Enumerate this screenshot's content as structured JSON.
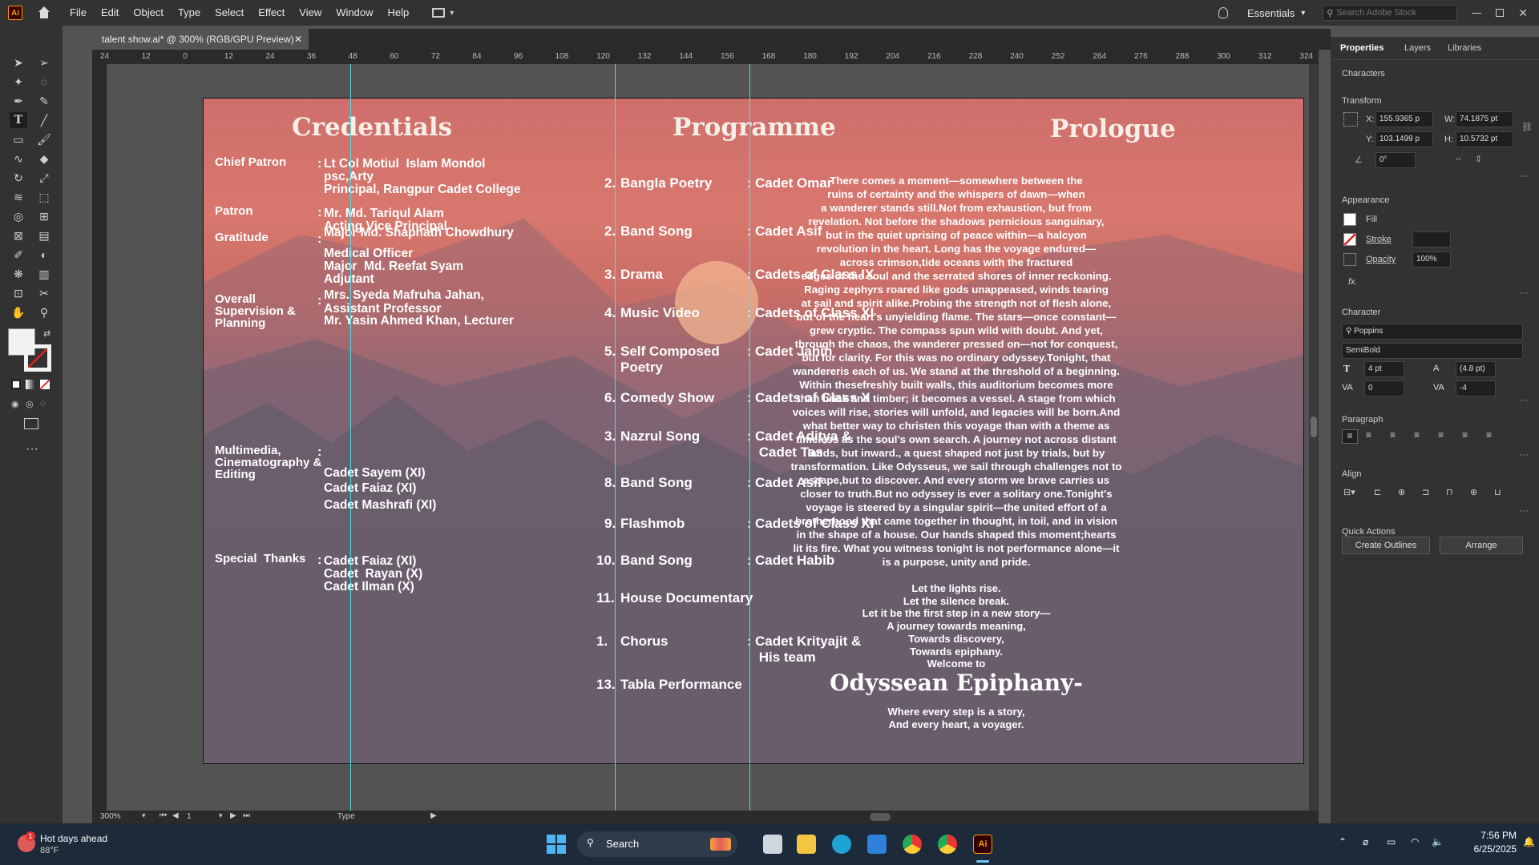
{
  "app": {
    "logo": "Ai",
    "menus": [
      "File",
      "Edit",
      "Object",
      "Type",
      "Select",
      "Effect",
      "View",
      "Window",
      "Help"
    ],
    "workspace": "Essentials",
    "search_placeholder": "Search Adobe Stock"
  },
  "document": {
    "tab_title": "talent show.ai* @ 300% (RGB/GPU Preview)"
  },
  "ruler_ticks": [
    "24",
    "12",
    "0",
    "12",
    "24",
    "36",
    "48",
    "60",
    "72",
    "84",
    "96",
    "108",
    "120",
    "132",
    "144",
    "156",
    "168",
    "180",
    "192",
    "204",
    "216",
    "228",
    "240",
    "252",
    "264",
    "276",
    "288",
    "300",
    "312",
    "324"
  ],
  "artboard": {
    "credentials": {
      "heading": "Credentials",
      "rows": [
        {
          "label": "Chief Patron",
          "sep": ":",
          "lines": [
            "Lt Col Motiul  Islam Mondol",
            "psc,Arty",
            "Principal, Rangpur Cadet College"
          ]
        },
        {
          "label": "Patron",
          "sep": ":",
          "lines": [
            "Mr. Md. Tariqul Alam",
            "Acting Vice Principal"
          ]
        },
        {
          "label": "Gratitude",
          "sep": ":",
          "lines": [
            "Major Md. Shaphath Chowdhury",
            "Medical Officer",
            "Major  Md. Reefat Syam",
            "Adjutant"
          ]
        },
        {
          "label": "Overall\nSupervision &\nPlanning",
          "sep": ":",
          "lines": [
            "Mrs. Syeda Mafruha Jahan,",
            "Assistant Professor",
            "Mr. Yasin Ahmed Khan, Lecturer"
          ]
        },
        {
          "label": "Multimedia,\nCinematography &\nEditing",
          "sep": ":",
          "lines": [
            "Cadet Sayem (XI)",
            "Cadet Faiaz (XI)",
            "Cadet Mashrafi (XI)"
          ]
        },
        {
          "label": "Special  Thanks",
          "sep": ":",
          "lines": [
            "Cadet Faiaz (XI)",
            "Cadet  Rayan (X)",
            "Cadet Ilman (X)"
          ]
        }
      ]
    },
    "programme": {
      "heading": "Programme",
      "items": [
        {
          "num": "2.",
          "name": "Bangla Poetry",
          "sep": ":",
          "by": "Cadet Omar"
        },
        {
          "num": "2.",
          "name": "Band Song",
          "sep": ":",
          "by": "Cadet Asif"
        },
        {
          "num": "3.",
          "name": "Drama",
          "sep": ":",
          "by": "Cadets of Class IX"
        },
        {
          "num": "4.",
          "name": "Music Video",
          "sep": ":",
          "by": "Cadets of Class XI"
        },
        {
          "num": "5.",
          "name": "Self Composed\nPoetry",
          "sep": ":",
          "by": "Cadet Jahin"
        },
        {
          "num": "6.",
          "name": "Comedy Show",
          "sep": ":",
          "by": "Cadets of Class X"
        },
        {
          "num": "3.",
          "name": "Nazrul Song",
          "sep": ":",
          "by": "Cadet Aditya &\n Cadet Tas"
        },
        {
          "num": "8.",
          "name": "Band Song",
          "sep": ":",
          "by": "Cadet Asif"
        },
        {
          "num": "9.",
          "name": "Flashmob",
          "sep": ":",
          "by": "Cadets of Class XI"
        },
        {
          "num": "10.",
          "name": "Band Song",
          "sep": ":",
          "by": "Cadet Habib"
        },
        {
          "num": "11.",
          "name": "House Documentary",
          "sep": "",
          "by": ""
        },
        {
          "num": "1.",
          "name": "Chorus",
          "sep": ":",
          "by": "Cadet Krityajit &\n His team"
        },
        {
          "num": "13.",
          "name": "Tabla Performance",
          "sep": "",
          "by": ""
        }
      ]
    },
    "prologue": {
      "heading": "Prologue",
      "body": "There comes a moment—somewhere between the\nruins of certainty and the whispers of dawn—when\na wanderer stands still.Not from exhaustion, but from\nrevelation. Not before the shadows pernicious sanguinary,\nbut in the quiet uprising of peace within—a halcyon\nrevolution in the heart. Long has the voyage endured—\nacross crimson,tide oceans with the fractured\nedges of the soul and the serrated shores of inner reckoning.\nRaging zephyrs roared like gods unappeased, winds tearing\nat sail and spirit alike.Probing the strength not of flesh alone,\nbut of the heart's unyielding flame. The stars—once constant—\ngrew cryptic.  The compass spun wild with doubt. And yet,\nthrough the chaos, the wanderer pressed on—not for conquest,\nbut for clarity. For this was no ordinary odyssey.Tonight, that\nwandereris each of us. We stand at the threshold of a beginning.\nWithin thesefreshly built walls, this auditorium becomes more\nthan brick and timber; it becomes a vessel. A stage from which\nvoices will rise, stories will unfold, and legacies will be born.And\nwhat better way to christen this voyage than with a theme as\ntimeless as the soul's own search. A journey not across distant\nlands, but inward., a quest shaped not just by trials, but by\ntransformation. Like Odysseus, we sail through challenges not to\nescape,but to discover. And every storm we brave carries us\ncloser to truth.But no odyssey is ever a solitary one.Tonight's\nvoyage is steered by a singular spirit—the united effort of a\nbrotherhood that came together in thought, in toil, and in vision\nin the shape of a house. Our hands shaped this moment;hearts\nlit its fire. What you witness tonight is not performance alone—it\nis a purpose, unity and pride.",
      "verse": "Let the lights rise.\nLet the silence break.\nLet it be the first step in a new story—\nA journey towards meaning,\nTowards discovery,\nTowards epiphany.\nWelcome to",
      "theme": "Odyssean Epiphany-",
      "closing": "Where every step is a story,\nAnd every heart, a voyager."
    }
  },
  "properties": {
    "tabs": [
      "Properties",
      "Layers",
      "Libraries"
    ],
    "selection": "Characters",
    "transform": {
      "label": "Transform",
      "x_label": "X:",
      "x": "155.9365 p",
      "y_label": "Y:",
      "y": "103.1499 p",
      "w_label": "W:",
      "w": "74.1875 pt",
      "h_label": "H:",
      "h": "10.5732 pt",
      "angle": "0°"
    },
    "appearance": {
      "label": "Appearance",
      "fill": "Fill",
      "stroke": "Stroke",
      "opacity": "Opacity",
      "opacity_value": "100%",
      "fx": "fx."
    },
    "character": {
      "label": "Character",
      "font": "Poppins",
      "style": "SemiBold",
      "size": "4 pt",
      "leading": "(4.8 pt)",
      "kerning": "0",
      "tracking": "-4"
    },
    "paragraph": {
      "label": "Paragraph"
    },
    "align": {
      "label": "Align"
    },
    "quick_actions": {
      "label": "Quick Actions",
      "create_outlines": "Create Outlines",
      "arrange": "Arrange"
    }
  },
  "status": {
    "zoom": "300%",
    "artboard": "1",
    "tool": "Type"
  },
  "taskbar": {
    "weather_title": "Hot days ahead",
    "weather_temp": "88°F",
    "weather_badge": "1",
    "search": "Search",
    "time": "7:56 PM",
    "date": "6/25/2025"
  },
  "colors": {
    "guide": "#48e0e8",
    "accent": "#ff9a00"
  }
}
